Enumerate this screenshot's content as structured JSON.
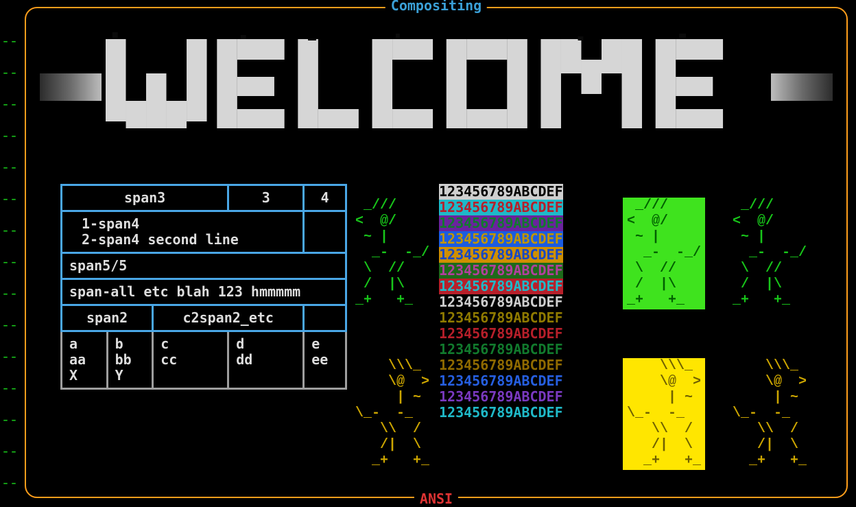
{
  "frame": {
    "title": "Compositing",
    "footer": "ANSI"
  },
  "table": {
    "r1": {
      "c1": "span3",
      "c2": "3",
      "c3": "4"
    },
    "r2": {
      "c1": "1-span4\n2-span4 second line"
    },
    "r3": {
      "c1": "span5/5"
    },
    "r4": {
      "c1": "span-all etc blah 123 hmmmmm"
    },
    "r5": {
      "c1": "span2",
      "c2": "c2span2_etc"
    },
    "r6": {
      "a": "a\naa\nX",
      "b": "b\nbb\nY",
      "c": "c\ncc\n ",
      "d": "d\ndd\n ",
      "e": "e\nee\n "
    }
  },
  "stick_fwd": " _///    \n<  @/    \n ~ |     \n  _-  -_/\n \\  //  \n /  |\\   \n_+   +_  ",
  "stick_rev": "    \\\\\\_ \n    \\@  >\n     | ~ \n\\_-  -_  \n   \\\\  / \n   /|  \\ \n  _+   +_",
  "hex": "123456789ABCDEF"
}
